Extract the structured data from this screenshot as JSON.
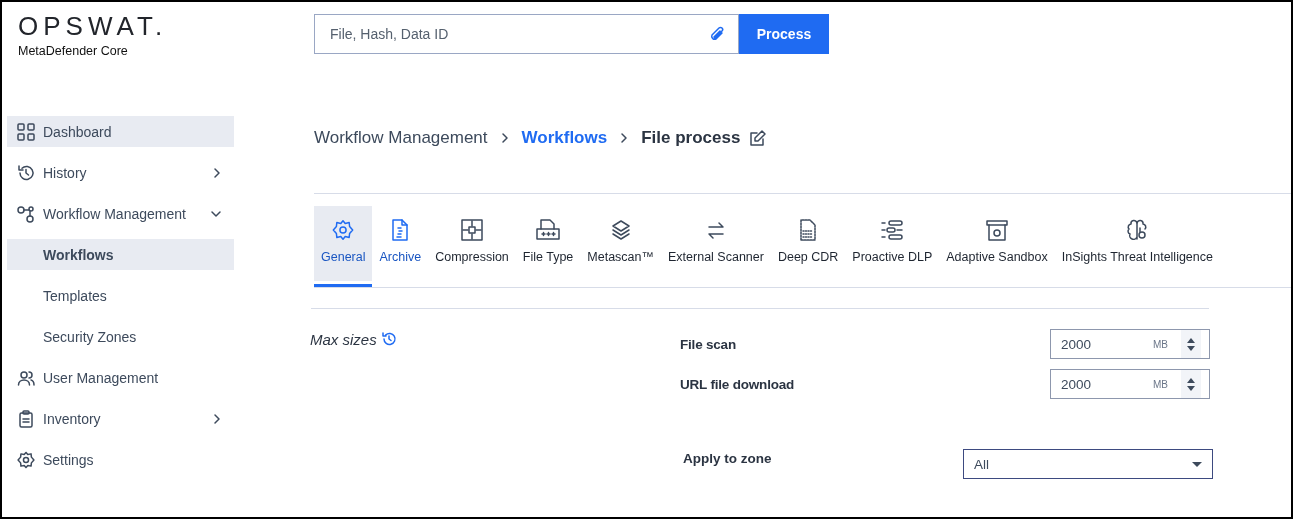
{
  "logo": {
    "brand": "OPSWAT.",
    "product": "MetaDefender Core"
  },
  "search": {
    "placeholder": "File, Hash, Data ID",
    "button": "Process"
  },
  "sidebar": {
    "items": [
      {
        "label": "Dashboard",
        "kind": "link",
        "selected": true
      },
      {
        "label": "History",
        "kind": "expandable",
        "selected": false,
        "expanded": false
      },
      {
        "label": "Workflow Management",
        "kind": "expandable",
        "selected": false,
        "expanded": true,
        "children": [
          {
            "label": "Workflows",
            "selected": true
          },
          {
            "label": "Templates",
            "selected": false
          },
          {
            "label": "Security Zones",
            "selected": false
          }
        ]
      },
      {
        "label": "User Management",
        "kind": "link",
        "selected": false
      },
      {
        "label": "Inventory",
        "kind": "expandable",
        "selected": false,
        "expanded": false
      },
      {
        "label": "Settings",
        "kind": "link",
        "selected": false
      }
    ]
  },
  "breadcrumb": [
    {
      "label": "Workflow Management",
      "kind": "plain"
    },
    {
      "label": "Workflows",
      "kind": "link"
    },
    {
      "label": "File process",
      "kind": "current"
    }
  ],
  "tabs": [
    {
      "label": "General",
      "selected": true,
      "hovered": false
    },
    {
      "label": "Archive",
      "selected": false,
      "hovered": true
    },
    {
      "label": "Compression",
      "selected": false,
      "hovered": false
    },
    {
      "label": "File Type",
      "selected": false,
      "hovered": false
    },
    {
      "label": "Metascan™",
      "selected": false,
      "hovered": false
    },
    {
      "label": "External Scanner",
      "selected": false,
      "hovered": false
    },
    {
      "label": "Deep CDR",
      "selected": false,
      "hovered": false
    },
    {
      "label": "Proactive DLP",
      "selected": false,
      "hovered": false
    },
    {
      "label": "Adaptive Sandbox",
      "selected": false,
      "hovered": false
    },
    {
      "label": "InSights Threat Intelligence",
      "selected": false,
      "hovered": false
    }
  ],
  "section": {
    "title": "Max sizes",
    "fields": [
      {
        "label": "File scan",
        "value": "2000",
        "unit": "MB"
      },
      {
        "label": "URL file download",
        "value": "2000",
        "unit": "MB"
      }
    ],
    "zone": {
      "label": "Apply to zone",
      "value": "All"
    }
  }
}
